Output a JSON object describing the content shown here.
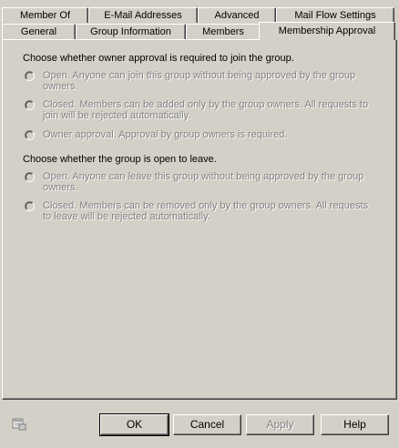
{
  "tabs_row_back": [
    {
      "label": "Member Of"
    },
    {
      "label": "E-Mail Addresses"
    },
    {
      "label": "Advanced"
    },
    {
      "label": "Mail Flow Settings"
    }
  ],
  "tabs_row_front": [
    {
      "label": "General"
    },
    {
      "label": "Group Information"
    },
    {
      "label": "Members"
    },
    {
      "label": "Membership Approval"
    }
  ],
  "join": {
    "title": "Choose whether owner approval is required to join the group.",
    "options": [
      {
        "label": "Open. Anyone can join this group without being approved by the group owners."
      },
      {
        "label": "Closed. Members can be added only by the group owners. All requests to join will be rejected automatically."
      },
      {
        "label": "Owner approval. Approval by group owners is required."
      }
    ]
  },
  "leave": {
    "title": "Choose whether the group is open to leave.",
    "options": [
      {
        "label": "Open. Anyone can leave this group without being approved by the group owners."
      },
      {
        "label": "Closed. Members can be removed only by the group owners. All requests to leave will be rejected automatically."
      }
    ]
  },
  "buttons": {
    "ok": "OK",
    "cancel": "Cancel",
    "apply": "Apply",
    "help": "Help"
  },
  "icons": {
    "status": "properties-page-icon"
  }
}
